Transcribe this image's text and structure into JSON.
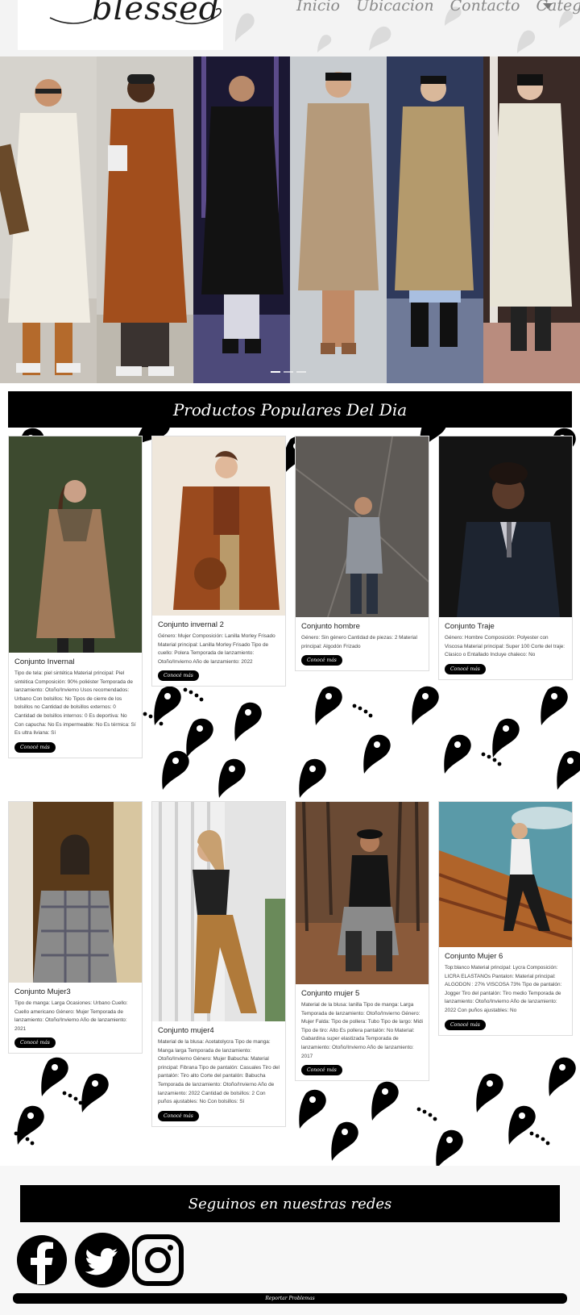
{
  "header": {
    "logo_text": "blessed",
    "nav": [
      "Inicio",
      "Ubicacion",
      "Contacto",
      "Categorias"
    ]
  },
  "hero": {
    "slides_count": 3
  },
  "products_section": {
    "title": "Productos Populares Del Dia",
    "button_label": "Conocé más",
    "cards": [
      {
        "title": "Conjunto Invernal",
        "desc": "Tipo de tela: piel sintética Material principal: Piel sintética Composición: 90% poliéster Temporada de lanzamiento: Otoño/Invierno Usos recomendados: Urbano Con bolsillos: No Tipos de cierre de los bolsillos no Cantidad de bolsillos externos: 0 Cantidad de bolsillos internos: 0 Es deportiva: No Con capucha: No Es impermeable: No Es térmica: Sí Es ultra liviana: Sí"
      },
      {
        "title": "Conjunto invernal 2",
        "desc": "Género: Mujer Composición: Lanilla Morley Frisado Material principal: Lanilla Morley Frisado Tipo de cuello: Polera Temporada de lanzamiento: Otoño/Invierno Año de lanzamiento: 2022"
      },
      {
        "title": "Conjunto hombre",
        "desc": "Género: Sin género Cantidad de piezas: 2 Material principal: Algodón Frizado"
      },
      {
        "title": "Conjunto Traje",
        "desc": "Género: Hombre Composición: Polyester con Viscosa Material principal: Super 100 Corte del traje: Clasico o Entallado Incluye chaleco: No"
      },
      {
        "title": "Conjunto Mujer3",
        "desc": "Tipo de manga: Larga Ocasiones: Urbano Cuello: Cuello americano Género: Mujer Temporada de lanzamiento: Otoño/Invierno Año de lanzamiento: 2021"
      },
      {
        "title": "Conjunto mujer4",
        "desc": "Material de la blusa: Acetatolycra Tipo de manga: Manga larga Temporada de lanzamiento: Otoño/Invierno Género: Mujer Babucha: Material principal: Fibrana Tipo de pantalón: Casuales Tiro del pantalón: Tiro alto Corte del pantalón: Babucha Temporada de lanzamiento: Otoño/Invierno Año de lanzamiento: 2022 Cantidad de bolsillos: 2 Con puños ajustables: No Con bolsillos: Sí"
      },
      {
        "title": "Conjunto mujer 5",
        "desc": "Material de la blusa: lanilla Tipo de manga: Larga Temporada de lanzamiento: Otoño/Invierno Género: Mujer Falda: Tipo de pollera: Tubo Tipo de largo: Midi Tipo de tiro: Alto Es pollera pantalón: No Material: Gabardina super elastizada Temporada de lanzamiento: Otoño/Invierno Año de lanzamiento: 2017"
      },
      {
        "title": "Conjunto Mujer 6",
        "desc": "Top:blanco Material principal: Lycra Composición: LICRA ELASTANOs Pantalon: Material principal: ALGODON : 27% VISCOSA 73% Tipo de pantalón: Jogger Tiro del pantalón: Tiro medio Temporada de lanzamiento: Otoño/Invierno Año de lanzamiento: 2022 Con puños ajustables: No"
      }
    ]
  },
  "footer": {
    "social_title": "Seguinos en nuestras redes",
    "social_icons": [
      "facebook-icon",
      "twitter-icon",
      "instagram-icon"
    ],
    "bottom_link": "Reportar Problemas"
  }
}
